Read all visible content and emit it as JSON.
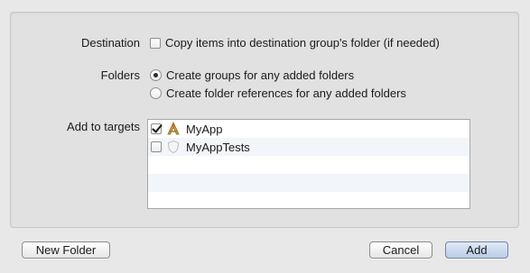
{
  "destination": {
    "label": "Destination",
    "checkbox_label": "Copy items into destination group's folder (if needed)",
    "checked": false
  },
  "folders": {
    "label": "Folders",
    "options": [
      {
        "label": "Create groups for any added folders",
        "selected": true
      },
      {
        "label": "Create folder references for any added folders",
        "selected": false
      }
    ]
  },
  "targets": {
    "label": "Add to targets",
    "items": [
      {
        "name": "MyApp",
        "checked": true,
        "icon": "app-icon"
      },
      {
        "name": "MyAppTests",
        "checked": false,
        "icon": "test-bundle-icon"
      }
    ]
  },
  "buttons": {
    "new_folder": "New Folder",
    "cancel": "Cancel",
    "add": "Add"
  }
}
